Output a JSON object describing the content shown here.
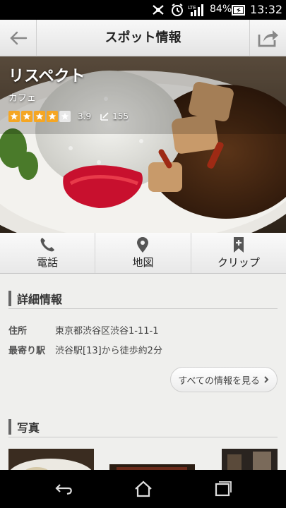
{
  "status_bar": {
    "battery_percent": "84%",
    "time": "13:32",
    "icons": [
      "mute-icon",
      "alarm-icon",
      "lte-signal-icon",
      "battery-icon"
    ]
  },
  "header": {
    "title": "スポット情報",
    "back_icon": "back-arrow-icon",
    "share_icon": "share-icon"
  },
  "spot": {
    "name": "リスペクト",
    "category": "カフェ",
    "rating": 3.9,
    "rating_label": "3.9",
    "stars_filled": 4,
    "stars_total": 5,
    "review_count": "155"
  },
  "actions": [
    {
      "label": "電話",
      "icon": "phone-icon"
    },
    {
      "label": "地図",
      "icon": "map-pin-icon"
    },
    {
      "label": "クリップ",
      "icon": "bookmark-add-icon"
    }
  ],
  "details": {
    "heading": "詳細情報",
    "rows": [
      {
        "key": "住所",
        "value": "東京都渋谷区渋谷1-11-1"
      },
      {
        "key": "最寄り駅",
        "value": "渋谷駅[13]から徒歩約2分"
      }
    ],
    "more_label": "すべての情報を見る"
  },
  "photos": {
    "heading": "写真"
  },
  "nav_bar": {
    "icons": [
      "back-icon",
      "home-icon",
      "recents-icon"
    ]
  },
  "colors": {
    "star": "#f5a623",
    "section_bar": "#666666",
    "background": "#efefed"
  }
}
